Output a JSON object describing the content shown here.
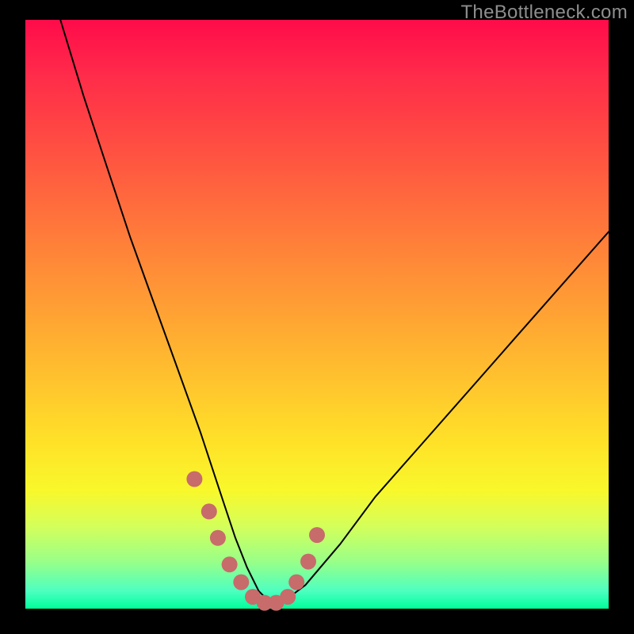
{
  "watermark": "TheBottleneck.com",
  "chart_data": {
    "type": "line",
    "title": "",
    "xlabel": "",
    "ylabel": "",
    "xlim": [
      0,
      100
    ],
    "ylim": [
      0,
      100
    ],
    "series": [
      {
        "name": "bottleneck-curve",
        "x": [
          6,
          10,
          14,
          18,
          22,
          26,
          30,
          32,
          34,
          36,
          38,
          40,
          42,
          44,
          48,
          54,
          60,
          68,
          76,
          84,
          92,
          100
        ],
        "values": [
          100,
          87,
          75,
          63,
          52,
          41,
          30,
          24,
          18,
          12,
          7,
          3,
          1,
          1,
          4,
          11,
          19,
          28,
          37,
          46,
          55,
          64
        ]
      }
    ],
    "highlight": {
      "name": "valley-dots",
      "color": "#c86b6b",
      "x": [
        29,
        31.5,
        33,
        35,
        37,
        39,
        41,
        43,
        45,
        46.5,
        48.5,
        50
      ],
      "values": [
        22,
        16.5,
        12,
        7.5,
        4.5,
        2,
        1,
        1,
        2,
        4.5,
        8,
        12.5
      ]
    }
  }
}
